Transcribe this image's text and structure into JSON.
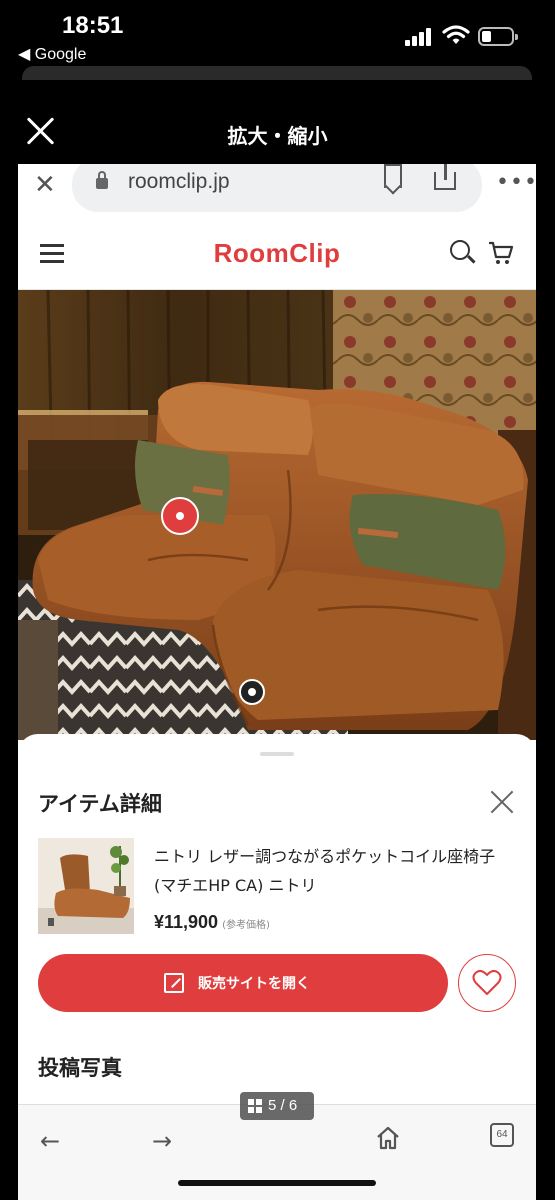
{
  "status_bar": {
    "time": "18:51",
    "back_app": "◀ Google"
  },
  "viewer": {
    "title": "拡大・縮小"
  },
  "browser": {
    "url": "roomclip.jp",
    "more": "•••"
  },
  "site": {
    "logo": "RoomClip"
  },
  "item_sheet": {
    "title": "アイテム詳細",
    "item_name": "ニトリ レザー調つながるポケットコイル座椅子(マチエHP CA) ニトリ",
    "price": "¥11,900",
    "price_note": "(参考価格)",
    "cta_label": "販売サイトを開く",
    "posts_title": "投稿写真"
  },
  "toolbar": {
    "back": "←",
    "forward": "→",
    "page_indicator": "5 / 6",
    "tab_count": "64"
  },
  "colors": {
    "brand": "#e03e3e",
    "background": "#000000",
    "sheet": "#ffffff"
  }
}
